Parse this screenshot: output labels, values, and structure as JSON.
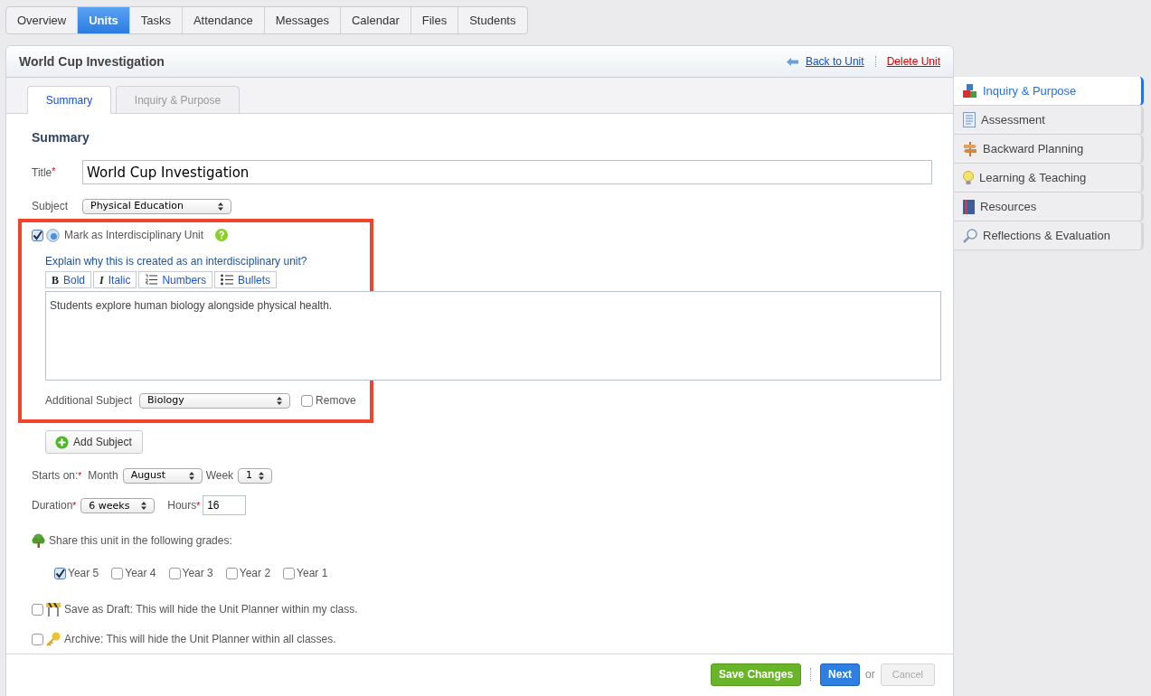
{
  "nav_tabs": [
    {
      "label": "Overview",
      "selected": false
    },
    {
      "label": "Units",
      "selected": true
    },
    {
      "label": "Tasks",
      "selected": false
    },
    {
      "label": "Attendance",
      "selected": false
    },
    {
      "label": "Messages",
      "selected": false
    },
    {
      "label": "Calendar",
      "selected": false
    },
    {
      "label": "Files",
      "selected": false
    },
    {
      "label": "Students",
      "selected": false
    }
  ],
  "unit": {
    "title": "World Cup Investigation",
    "back_link": "Back to Unit",
    "delete_link": "Delete Unit"
  },
  "sub_tabs": [
    {
      "label": "Summary",
      "selected": true
    },
    {
      "label": "Inquiry & Purpose",
      "selected": false
    }
  ],
  "form": {
    "heading": "Summary",
    "title_field": {
      "label": "Title",
      "required_mark": "*",
      "value": "World Cup Investigation"
    },
    "subject": {
      "label": "Subject",
      "value": "Physical Education"
    },
    "interdisciplinary": {
      "checked": true,
      "label": "Mark as Interdisciplinary Unit",
      "prompt": "Explain why this is created as an interdisciplinary unit?",
      "toolbar": [
        {
          "kind": "bold",
          "glyph": "B",
          "label": "Bold"
        },
        {
          "kind": "italic",
          "glyph": "I",
          "label": "Italic"
        },
        {
          "kind": "numbers",
          "label": "Numbers"
        },
        {
          "kind": "bullets",
          "label": "Bullets"
        }
      ],
      "text": "Students explore human biology alongside physical health.",
      "additional_subject_label": "Additional Subject",
      "additional_subject": "Biology",
      "remove": {
        "label": "Remove",
        "checked": false
      }
    },
    "add_subject": "Add Subject",
    "starts_on": {
      "label": "Starts on:",
      "required_mark": "*",
      "month_label": "Month",
      "month": "August",
      "week_label": "Week",
      "week": "1"
    },
    "duration": {
      "label": "Duration",
      "required_mark": "*",
      "value": "6 weeks",
      "hours_label": "Hours",
      "hours_required_mark": "*",
      "hours": "16"
    },
    "share": {
      "label": "Share this unit in the following grades:",
      "grades": [
        {
          "label": "Year 5",
          "checked": true
        },
        {
          "label": "Year 4",
          "checked": false
        },
        {
          "label": "Year 3",
          "checked": false
        },
        {
          "label": "Year 2",
          "checked": false
        },
        {
          "label": "Year 1",
          "checked": false
        }
      ]
    },
    "options": [
      {
        "kind": "draft",
        "label": "Save as Draft: This will hide the Unit Planner within my class.",
        "checked": false
      },
      {
        "kind": "archive",
        "label": "Archive: This will hide the Unit Planner within all classes.",
        "checked": false
      }
    ]
  },
  "footer": {
    "save": "Save Changes",
    "next": "Next",
    "or": "or",
    "cancel": {
      "label": "Cancel",
      "disabled": true
    }
  },
  "sidebar": [
    {
      "kind": "blocks",
      "label": "Inquiry & Purpose",
      "selected": true
    },
    {
      "kind": "document",
      "label": "Assessment",
      "selected": false
    },
    {
      "kind": "signpost",
      "label": "Backward Planning",
      "selected": false
    },
    {
      "kind": "bulb",
      "label": "Learning & Teaching",
      "selected": false
    },
    {
      "kind": "book",
      "label": "Resources",
      "selected": false
    },
    {
      "kind": "magnifier",
      "label": "Reflections & Evaluation",
      "selected": false
    }
  ]
}
